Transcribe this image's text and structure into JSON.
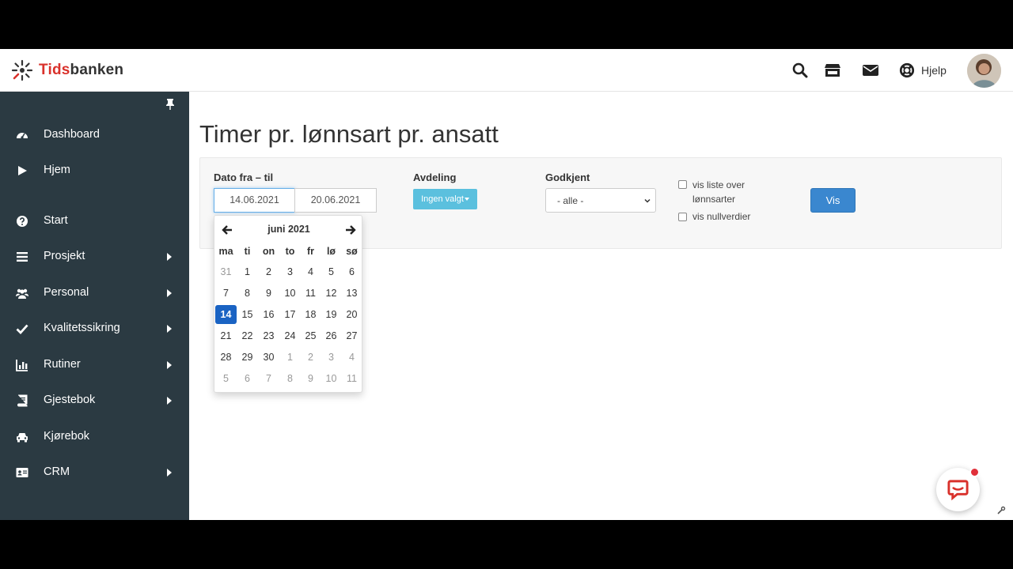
{
  "header": {
    "logo_text_a": "Tids",
    "logo_text_b": "banken",
    "help_label": "Hjelp",
    "icons": [
      "search-icon",
      "store-icon",
      "envelope-icon",
      "lifebuoy-icon"
    ]
  },
  "sidebar": {
    "items": [
      {
        "label": "Dashboard",
        "icon": "dashboard-icon",
        "submenu": false
      },
      {
        "label": "Hjem",
        "icon": "play-icon",
        "submenu": false
      },
      {
        "label": "Start",
        "icon": "question-circle-icon",
        "submenu": false
      },
      {
        "label": "Prosjekt",
        "icon": "list-icon",
        "submenu": true
      },
      {
        "label": "Personal",
        "icon": "users-icon",
        "submenu": true
      },
      {
        "label": "Kvalitetssikring",
        "icon": "check-icon",
        "submenu": true
      },
      {
        "label": "Rutiner",
        "icon": "bar-chart-icon",
        "submenu": true
      },
      {
        "label": "Gjestebok",
        "icon": "book-icon",
        "submenu": true
      },
      {
        "label": "Kjørebok",
        "icon": "car-icon",
        "submenu": false
      },
      {
        "label": "CRM",
        "icon": "id-card-icon",
        "submenu": true
      }
    ]
  },
  "main": {
    "title": "Timer pr. lønnsart pr. ansatt",
    "filters": {
      "date_label": "Dato fra – til",
      "date_from": "14.06.2021",
      "date_to": "20.06.2021",
      "avdeling_label": "Avdeling",
      "avdeling_value": "Ingen valgt",
      "godkjent_label": "Godkjent",
      "godkjent_value": "- alle -",
      "check_list_label_1": "vis liste over",
      "check_list_label_2": "lønnsarter",
      "check_null_label": "vis nullverdier",
      "vis_button": "Vis"
    },
    "datepicker": {
      "month": "juni 2021",
      "weekdays": [
        "ma",
        "ti",
        "on",
        "to",
        "fr",
        "lø",
        "sø"
      ],
      "weeks": [
        [
          "31",
          "1",
          "2",
          "3",
          "4",
          "5",
          "6"
        ],
        [
          "7",
          "8",
          "9",
          "10",
          "11",
          "12",
          "13"
        ],
        [
          "14",
          "15",
          "16",
          "17",
          "18",
          "19",
          "20"
        ],
        [
          "21",
          "22",
          "23",
          "24",
          "25",
          "26",
          "27"
        ],
        [
          "28",
          "29",
          "30",
          "1",
          "2",
          "3",
          "4"
        ],
        [
          "5",
          "6",
          "7",
          "8",
          "9",
          "10",
          "11"
        ]
      ],
      "selected": "14"
    }
  },
  "colors": {
    "sidebar_bg": "#2b3a42",
    "accent_blue": "#3a87cf",
    "selected_day": "#1a63c3",
    "info_button": "#5bc0de",
    "brand_red": "#d9312b"
  }
}
